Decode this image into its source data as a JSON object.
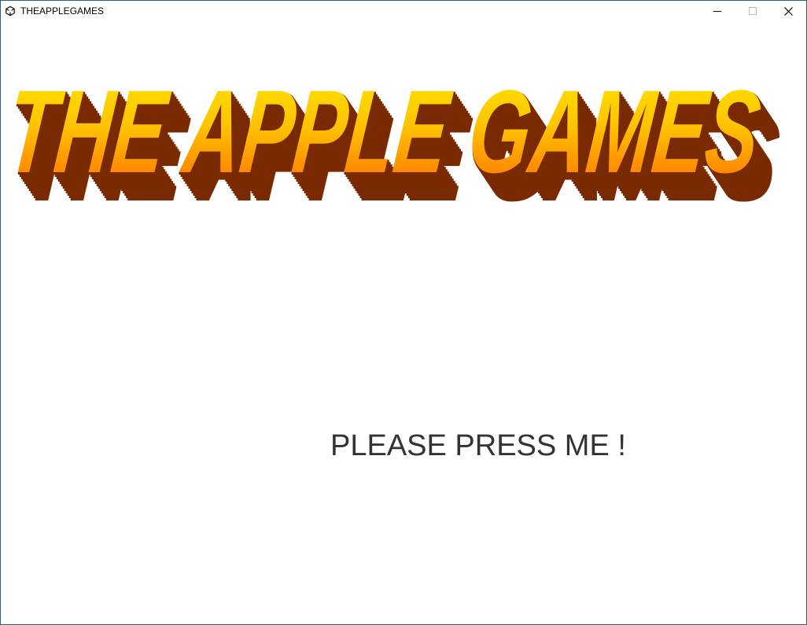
{
  "window": {
    "title": "THEAPPLEGAMES",
    "icon": "unity-icon",
    "controls": [
      "minimize-icon",
      "maximize-icon",
      "close-icon"
    ]
  },
  "logo": {
    "text": "THE APPLE GAMES",
    "colors": {
      "fill_top": "#FFE600",
      "fill_bottom": "#FF6A00",
      "extrusion": "#7A2A00"
    }
  },
  "main_button": {
    "label": "PLEASE PRESS ME !",
    "color": "#333333"
  }
}
